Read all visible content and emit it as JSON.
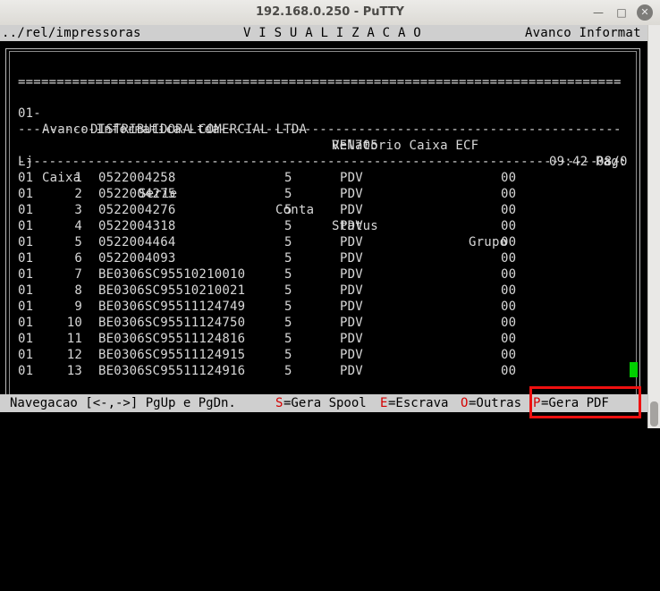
{
  "window": {
    "title": "192.168.0.250 - PuTTY"
  },
  "header": {
    "path": "../rel/impressoras",
    "center": "V I S U A L I Z A C A O",
    "right": "Avanco Informat"
  },
  "report": {
    "separator_double": "==============================================================================",
    "separator_dash": "------------------------------------------------------------------------------",
    "code": "01-",
    "company": "DISTRIBUIDORA COMERCIAL LTDA",
    "report_name": "Relatorio Caixa ECF",
    "date": "08/0",
    "vendor": "Avanco Informatica Ltda",
    "program": "VEN705",
    "time_page": "09:42 Pag:"
  },
  "table": {
    "columns": [
      "Lj",
      "Caixa",
      "Serie",
      "Conta",
      "Status",
      "Grupo"
    ],
    "rows": [
      [
        "01",
        "1",
        "0522004258",
        "5",
        "PDV",
        "00"
      ],
      [
        "01",
        "2",
        "0522004275",
        "5",
        "PDV",
        "00"
      ],
      [
        "01",
        "3",
        "0522004276",
        "5",
        "PDV",
        "00"
      ],
      [
        "01",
        "4",
        "0522004318",
        "5",
        "PDV",
        "00"
      ],
      [
        "01",
        "5",
        "0522004464",
        "5",
        "PDV",
        "00"
      ],
      [
        "01",
        "6",
        "0522004093",
        "5",
        "PDV",
        "00"
      ],
      [
        "01",
        "7",
        "BE0306SC95510210010",
        "5",
        "PDV",
        "00"
      ],
      [
        "01",
        "8",
        "BE0306SC95510210021",
        "5",
        "PDV",
        "00"
      ],
      [
        "01",
        "9",
        "BE0306SC95511124749",
        "5",
        "PDV",
        "00"
      ],
      [
        "01",
        "10",
        "BE0306SC95511124750",
        "5",
        "PDV",
        "00"
      ],
      [
        "01",
        "11",
        "BE0306SC95511124816",
        "5",
        "PDV",
        "00"
      ],
      [
        "01",
        "12",
        "BE0306SC95511124915",
        "5",
        "PDV",
        "00"
      ],
      [
        "01",
        "13",
        "BE0306SC95511124916",
        "5",
        "PDV",
        "00"
      ]
    ]
  },
  "footer": {
    "navigation": "Navegacao [<-,->] PgUp e PgDn.",
    "spool_key": "S",
    "spool_label": "=Gera Spool",
    "slave_key": "E",
    "slave_label": "=Escrava",
    "others_key": "O",
    "others_label": "=Outras",
    "pdf_key": "P",
    "pdf_label": "=Gera PDF"
  },
  "colors": {
    "highlight": "#ee1010",
    "cursor": "#00d000",
    "hotkey": "#d40000"
  },
  "icons": {
    "minimize": "minimize-icon",
    "maximize": "maximize-icon",
    "close": "close-icon"
  }
}
